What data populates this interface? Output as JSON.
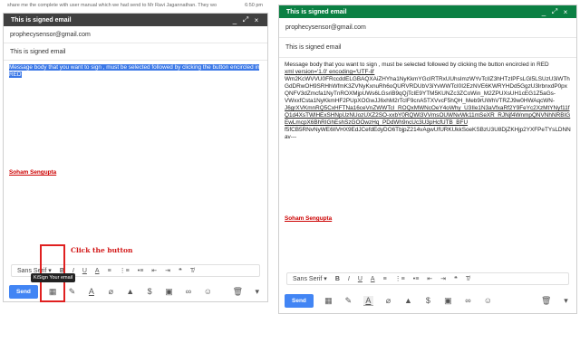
{
  "background": {
    "snippet": "share me the complete with user manual which we had send to Mr Ravi Jagannathan. They wo",
    "time": "6:50 pm"
  },
  "left": {
    "title": "This is signed email",
    "controls": [
      "_",
      "⤢",
      "×"
    ],
    "to": "prophecysensor@gmail.com",
    "subject": "This is signed email",
    "message": "Message body that you want to sign , must be selected followed by clicking the button encircled in RED",
    "signature": "Soham Sengupta",
    "font": "Sans Serif",
    "send": "Send",
    "tooltip": "KiSign Your email",
    "callout": "Click the button"
  },
  "right": {
    "title": "This is signed email",
    "controls": [
      "_",
      "⤢",
      "×"
    ],
    "to": "prophecysensor@gmail.com",
    "subject": "This is signed email",
    "message": "Message body that you want to sign , must be selected followed by clicking the button encircled in RED",
    "pgp_lines": [
      "xml version='1.0' encoding='UTF-8'",
      "Wm2KcWVVU0FRccddELGBAQXAiZHYha1NyKkmYGcIRTRxUUhsImzWYvTcIlZ3hHTzIPFsLGl5LSUzU3iWThGdDRwOH9SRHhWfmK3ZVNyKxnuRh6oQURVRDUbV3iYvWWTcI0I2EzNVE6KWRYHDd5GgzU3lrbnxdP0pxQNFV3dZmcfa1NyTnROXMjpUWs6LGsriB9qQjTcIE9YTM5KUNZc3ZCoWin_M2ZPUXsUH1cEG1Z5aGs-",
      "VWxxfCsta1NyKkmHF2PUpXOGwJJ6xhM2rTcIF9cnA5TXVvcF5hQH_Meb9rUWhVTRZJ9w0HWAqcWN-",
      "J6grXVKmnRQ5CxHFTNa16ceVnZWWTcI_ROQxMWNcOeY4oWhy_U3IIe1N3aVfxaRf2Y9FeYc2XzMtYNyf11fQ1d4XsTWlHExSHNpUzNUozUXZ2SO-xxbY0RQWl3VVmsOUWNvWk11mSeXR_RJNjf4WnmpQNVNhNRBIGEwLmcpX6BhRIGhEshSzGOOwzHq_PDdWh9ncUc3U3pHcfUTB_BFU",
      "f5fCB5RNvNyWE6IlVHX9EdJCefdEdyDO6TbjpZ214vAgwUfURKUkkSoeKSBzU3U8DjZKHjp2YXFPeTYsLDNNav---"
    ],
    "signature": "Soham Sengupta",
    "font": "Sans Serif",
    "send": "Send"
  },
  "icons": {
    "format_buttons": [
      "B",
      "I",
      "U",
      "A",
      "≡",
      "⋮≡",
      "•≡",
      "⇤",
      "⇥",
      "❝",
      "T̸"
    ],
    "bottom": [
      "format-icon",
      "sign-icon",
      "font-color-icon",
      "attach-icon",
      "drive-icon",
      "dollar-icon",
      "photo-icon",
      "link-icon",
      "emoji-icon",
      "trash-icon",
      "more-icon"
    ]
  }
}
